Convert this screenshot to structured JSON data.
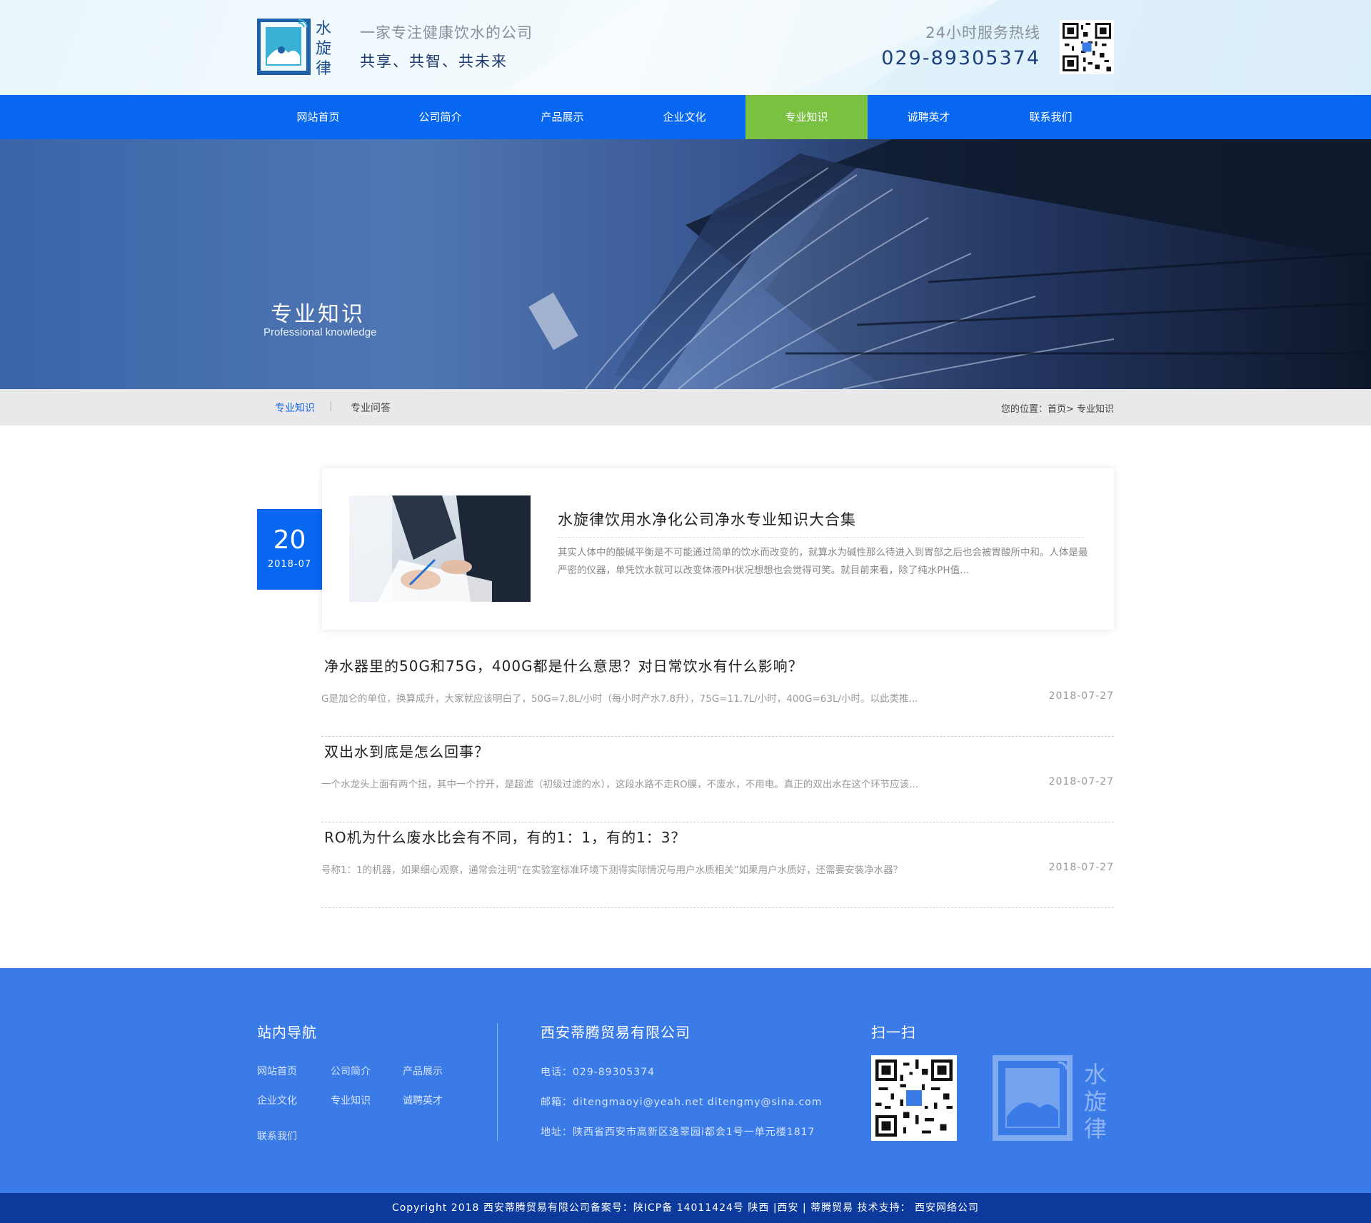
{
  "header": {
    "slogan_line1": "一家专注健康饮水的公司",
    "slogan_line2": "共享、共智、共未来",
    "hotline_label": "24小时服务热线",
    "hotline_number": "029-89305374",
    "logo_text": [
      "水",
      "旋",
      "律"
    ]
  },
  "nav": {
    "items": [
      {
        "label": "网站首页"
      },
      {
        "label": "公司简介"
      },
      {
        "label": "产品展示"
      },
      {
        "label": "企业文化"
      },
      {
        "label": "专业知识",
        "active": true
      },
      {
        "label": "诚聘英才"
      },
      {
        "label": "联系我们"
      }
    ]
  },
  "banner": {
    "title": "专业知识",
    "subtitle": "Professional knowledge"
  },
  "subnav": {
    "tab1": "专业知识",
    "separator": "|",
    "tab2": "专业问答",
    "breadcrumb": "您的位置：首页> 专业知识"
  },
  "featured": {
    "day": "20",
    "year_month": "2018-07",
    "title": "水旋律饮用水净化公司净水专业知识大合集",
    "description": "其实人体中的酸碱平衡是不可能通过简单的饮水而改变的，就算水为碱性那么待进入到胃部之后也会被胃酸所中和。人体是最严密的仪器，单凭饮水就可以改变体液PH状况想想也会觉得可笑。就目前来看，除了纯水PH值..."
  },
  "articles": [
    {
      "title": "净水器里的50G和75G，400G都是什么意思？对日常饮水有什么影响？",
      "desc": "G是加仑的单位，换算成升，大家就应该明白了，50G=7.8L/小时（每小时产水7.8升），75G=11.7L/小时，400G=63L/小时。以此类推...",
      "date": "2018-07-27"
    },
    {
      "title": "双出水到底是怎么回事？",
      "desc": "一个水龙头上面有两个扭，其中一个拧开，是超滤（初级过滤的水），这段水路不走RO膜，不废水，不用电。真正的双出水在这个环节应该...",
      "date": "2018-07-27"
    },
    {
      "title": "RO机为什么废水比会有不同，有的1：1，有的1：3？",
      "desc": "号称1：1的机器，如果细心观察，通常会注明“在实验室标准环境下测得实际情况与用户水质相关”如果用户水质好，还需要安装净水器？",
      "date": "2018-07-27"
    }
  ],
  "footer": {
    "nav_heading": "站内导航",
    "nav_links": [
      "网站首页",
      "公司简介",
      "产品展示",
      "企业文化",
      "专业知识",
      "诚聘英才",
      "联系我们"
    ],
    "company_heading": "西安蒂腾贸易有限公司",
    "phone": "电话：029-89305374",
    "email": "邮箱：ditengmaoyi@yeah.net  ditengmy@sina.com",
    "address": "地址：陕西省西安市高新区逸翠园i都会1号一单元楼1817",
    "scan_heading": "扫一扫",
    "copyright": "Copyright  2018 西安蒂腾贸易有限公司备案号：陕ICP备 14011424号    陕西 |西安 |  蒂腾贸易    技术支持： 西安网络公司"
  },
  "colors": {
    "nav_blue": "#0767f0",
    "active_green": "#7ac142",
    "footer_blue": "#3a7be8",
    "copyright_blue": "#0b3a9c"
  }
}
